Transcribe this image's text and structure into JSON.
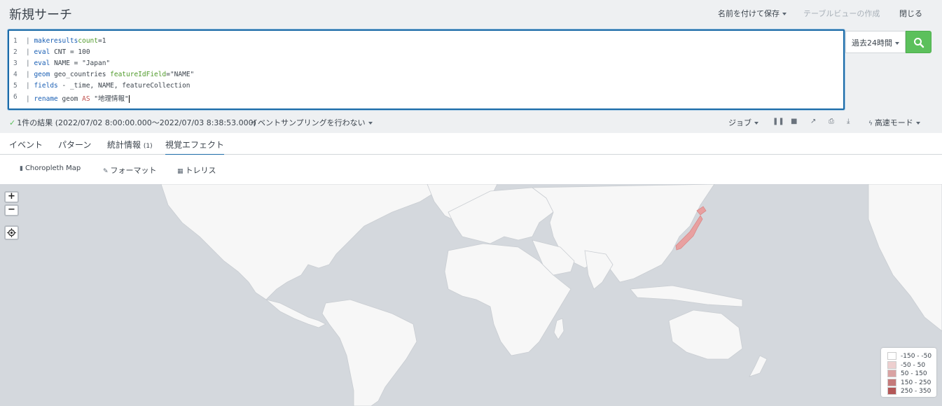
{
  "header": {
    "title": "新規サーチ",
    "save_as": "名前を付けて保存",
    "table_view": "テーブルビューの作成",
    "close": "閉じる"
  },
  "editor": {
    "lines": [
      {
        "num": "1",
        "pipe": "|",
        "cmd": "makeresults",
        "rest": [
          {
            "t": "count",
            "c": "arg"
          },
          {
            "t": "=1",
            "c": "plain"
          }
        ]
      },
      {
        "num": "2",
        "pipe": "|",
        "cmd": "eval",
        "rest": [
          {
            "t": " CNT = 100",
            "c": "plain"
          }
        ]
      },
      {
        "num": "3",
        "pipe": "|",
        "cmd": "eval",
        "rest": [
          {
            "t": " NAME = \"Japan\"",
            "c": "plain"
          }
        ]
      },
      {
        "num": "4",
        "pipe": "|",
        "cmd": "geom",
        "rest": [
          {
            "t": " geo_countries ",
            "c": "plain"
          },
          {
            "t": "featureIdField",
            "c": "arg"
          },
          {
            "t": "=\"NAME\"",
            "c": "plain"
          }
        ]
      },
      {
        "num": "5",
        "pipe": "|",
        "cmd": "fields",
        "rest": [
          {
            "t": " - _time, NAME, featureCollection",
            "c": "plain"
          }
        ]
      },
      {
        "num": "6",
        "pipe": "|",
        "cmd": "rename",
        "rest": [
          {
            "t": " geom ",
            "c": "plain"
          },
          {
            "t": "AS",
            "c": "op"
          },
          {
            "t": " \"地理情報\"",
            "c": "str"
          }
        ]
      }
    ]
  },
  "time_picker": {
    "label": "過去24時間"
  },
  "status": {
    "result": "1件の結果 (2022/07/02 8:00:00.000〜2022/07/03 8:38:53.000)",
    "sampling": "イベントサンプリングを行わない",
    "job": "ジョブ",
    "mode": "高速モード"
  },
  "tabs": [
    {
      "label": "イベント",
      "count": ""
    },
    {
      "label": "パターン",
      "count": ""
    },
    {
      "label": "統計情報",
      "count": "(1)"
    },
    {
      "label": "視覚エフェクト",
      "count": ""
    }
  ],
  "viz_toolbar": {
    "chart_type": "Choropleth Map",
    "format": "フォーマット",
    "trellis": "トレリス"
  },
  "map": {
    "zoom_in": "+",
    "zoom_out": "−",
    "land_color": "#f7f7f7",
    "water_color": "#d4d8dd",
    "highlight_color": "#e8a0a0"
  },
  "legend": [
    {
      "label": "-150 - -50",
      "color": "#ffffff"
    },
    {
      "label": "-50 - 50",
      "color": "#edcfcf"
    },
    {
      "label": "50 - 150",
      "color": "#d9a3a3"
    },
    {
      "label": "150 - 250",
      "color": "#c57a7a"
    },
    {
      "label": "250 - 350",
      "color": "#b35757"
    }
  ]
}
